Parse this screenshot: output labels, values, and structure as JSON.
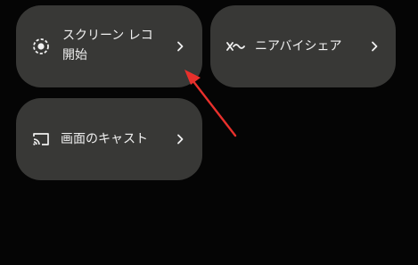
{
  "tiles": {
    "screen_record": {
      "label_line1": "スクリーン レコ",
      "label_line2": "開始",
      "icon": "screen-record-icon"
    },
    "nearby_share": {
      "label": "ニアバイシェア",
      "icon": "nearby-share-icon"
    },
    "cast": {
      "label": "画面のキャスト",
      "icon": "cast-icon"
    }
  },
  "colors": {
    "background": "#050505",
    "tile": "#383836",
    "text": "#f0f0f0",
    "annotation_arrow": "#e8302c"
  }
}
